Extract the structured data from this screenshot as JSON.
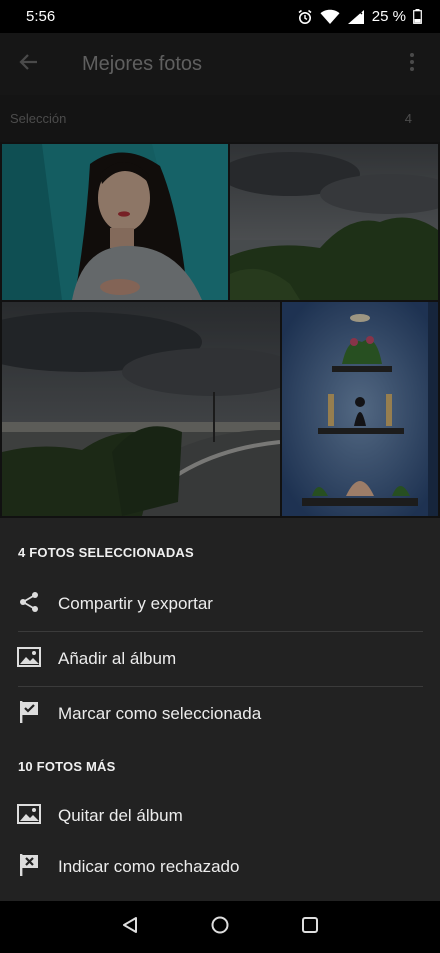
{
  "status": {
    "time": "5:56",
    "battery": "25 %"
  },
  "app_bar": {
    "title": "Mejores fotos"
  },
  "selection_header": {
    "label": "Selección",
    "count": "4"
  },
  "sheet": {
    "section1_title": "4 FOTOS SELECCIONADAS",
    "section1_items": [
      {
        "label": "Compartir y exportar",
        "icon": "share-icon"
      },
      {
        "label": "Añadir al álbum",
        "icon": "add-to-album-icon"
      },
      {
        "label": "Marcar como seleccionada",
        "icon": "flag-pick-icon"
      }
    ],
    "section2_title": "10 FOTOS MÁS",
    "section2_items": [
      {
        "label": "Quitar del álbum",
        "icon": "remove-from-album-icon"
      },
      {
        "label": "Indicar como rechazado",
        "icon": "flag-reject-icon"
      }
    ]
  },
  "colors": {
    "sheet_bg": "#222222",
    "app_bar_bg": "#161616",
    "accent_teal": "#1f8f96"
  }
}
